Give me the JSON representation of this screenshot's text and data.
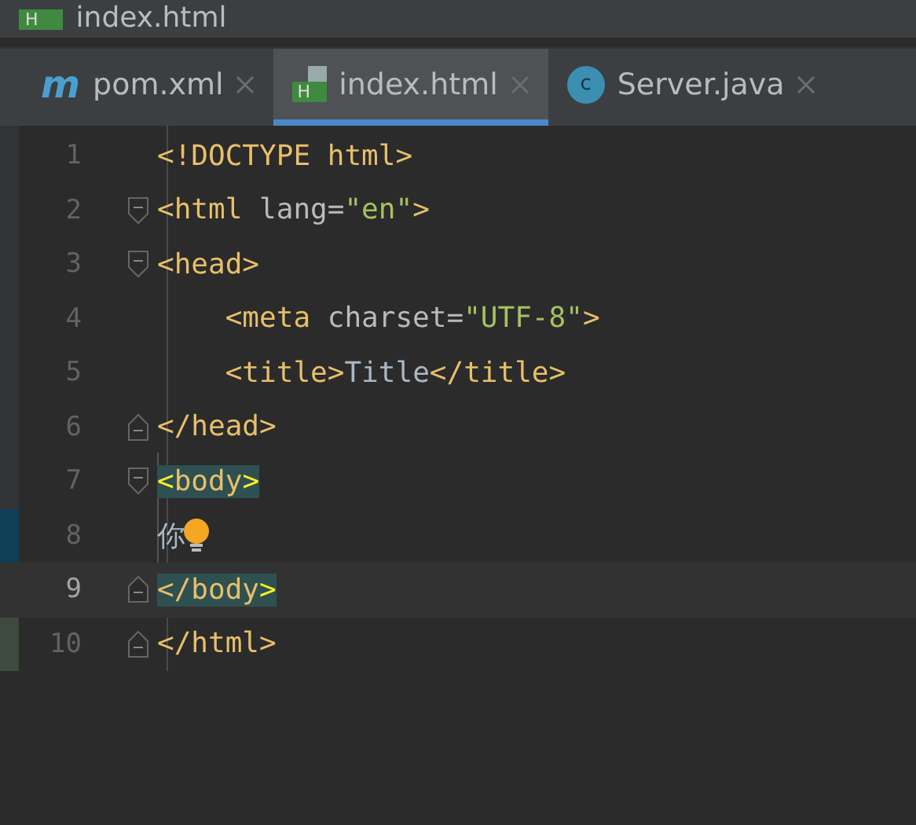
{
  "window": {
    "title": "index.html",
    "badge": "H"
  },
  "tabs": [
    {
      "label": "pom.xml",
      "badge": "m",
      "selected": false
    },
    {
      "label": "index.html",
      "badge": "H",
      "selected": true
    },
    {
      "label": "Server.java",
      "badge": "c",
      "selected": false
    }
  ],
  "editor": {
    "lines": [
      {
        "number": "1",
        "current": false,
        "fold_open": false,
        "fold_close": false,
        "modified": false,
        "added": false,
        "tokens": [
          {
            "kind": "tag",
            "text": "<!DOCTYPE html>"
          }
        ]
      },
      {
        "number": "2",
        "current": false,
        "fold_open": true,
        "fold_close": false,
        "modified": false,
        "added": false,
        "tokens": [
          {
            "kind": "tag",
            "text": "<html "
          },
          {
            "kind": "attr",
            "text": "lang="
          },
          {
            "kind": "value",
            "text": "\"en\""
          },
          {
            "kind": "tag",
            "text": ">"
          }
        ]
      },
      {
        "number": "3",
        "current": false,
        "fold_open": true,
        "fold_close": false,
        "modified": false,
        "added": false,
        "tokens": [
          {
            "kind": "tag",
            "text": "<head>"
          }
        ]
      },
      {
        "number": "4",
        "current": false,
        "fold_open": false,
        "fold_close": false,
        "modified": false,
        "added": false,
        "tokens": [
          {
            "kind": "tag",
            "text": "    <meta "
          },
          {
            "kind": "attr",
            "text": "charset="
          },
          {
            "kind": "value",
            "text": "\"UTF-8\""
          },
          {
            "kind": "tag",
            "text": ">"
          }
        ]
      },
      {
        "number": "5",
        "current": false,
        "fold_open": false,
        "fold_close": false,
        "modified": false,
        "added": false,
        "tokens": [
          {
            "kind": "tag",
            "text": "    <title>"
          },
          {
            "kind": "text",
            "text": "Title"
          },
          {
            "kind": "tag",
            "text": "</title>"
          }
        ]
      },
      {
        "number": "6",
        "current": false,
        "fold_open": false,
        "fold_close": true,
        "modified": false,
        "added": false,
        "tokens": [
          {
            "kind": "tag",
            "text": "</head>"
          }
        ]
      },
      {
        "number": "7",
        "current": false,
        "fold_open": true,
        "fold_close": false,
        "modified": false,
        "added": false,
        "tokens": [
          {
            "kind": "match",
            "text": "<"
          },
          {
            "kind": "matched-tag",
            "text": "body"
          },
          {
            "kind": "match",
            "text": ">"
          }
        ]
      },
      {
        "number": "8",
        "current": false,
        "fold_open": false,
        "fold_close": false,
        "modified": true,
        "added": false,
        "bulb": true,
        "tokens": [
          {
            "kind": "text",
            "text": "你"
          }
        ]
      },
      {
        "number": "9",
        "current": true,
        "fold_open": false,
        "fold_close": true,
        "modified": false,
        "added": false,
        "tokens": [
          {
            "kind": "matched-tag",
            "text": "</body"
          },
          {
            "kind": "match",
            "text": ">"
          }
        ]
      },
      {
        "number": "10",
        "current": false,
        "fold_open": false,
        "fold_close": true,
        "modified": false,
        "added": true,
        "tokens": [
          {
            "kind": "tag",
            "text": "</html>"
          }
        ]
      }
    ]
  }
}
